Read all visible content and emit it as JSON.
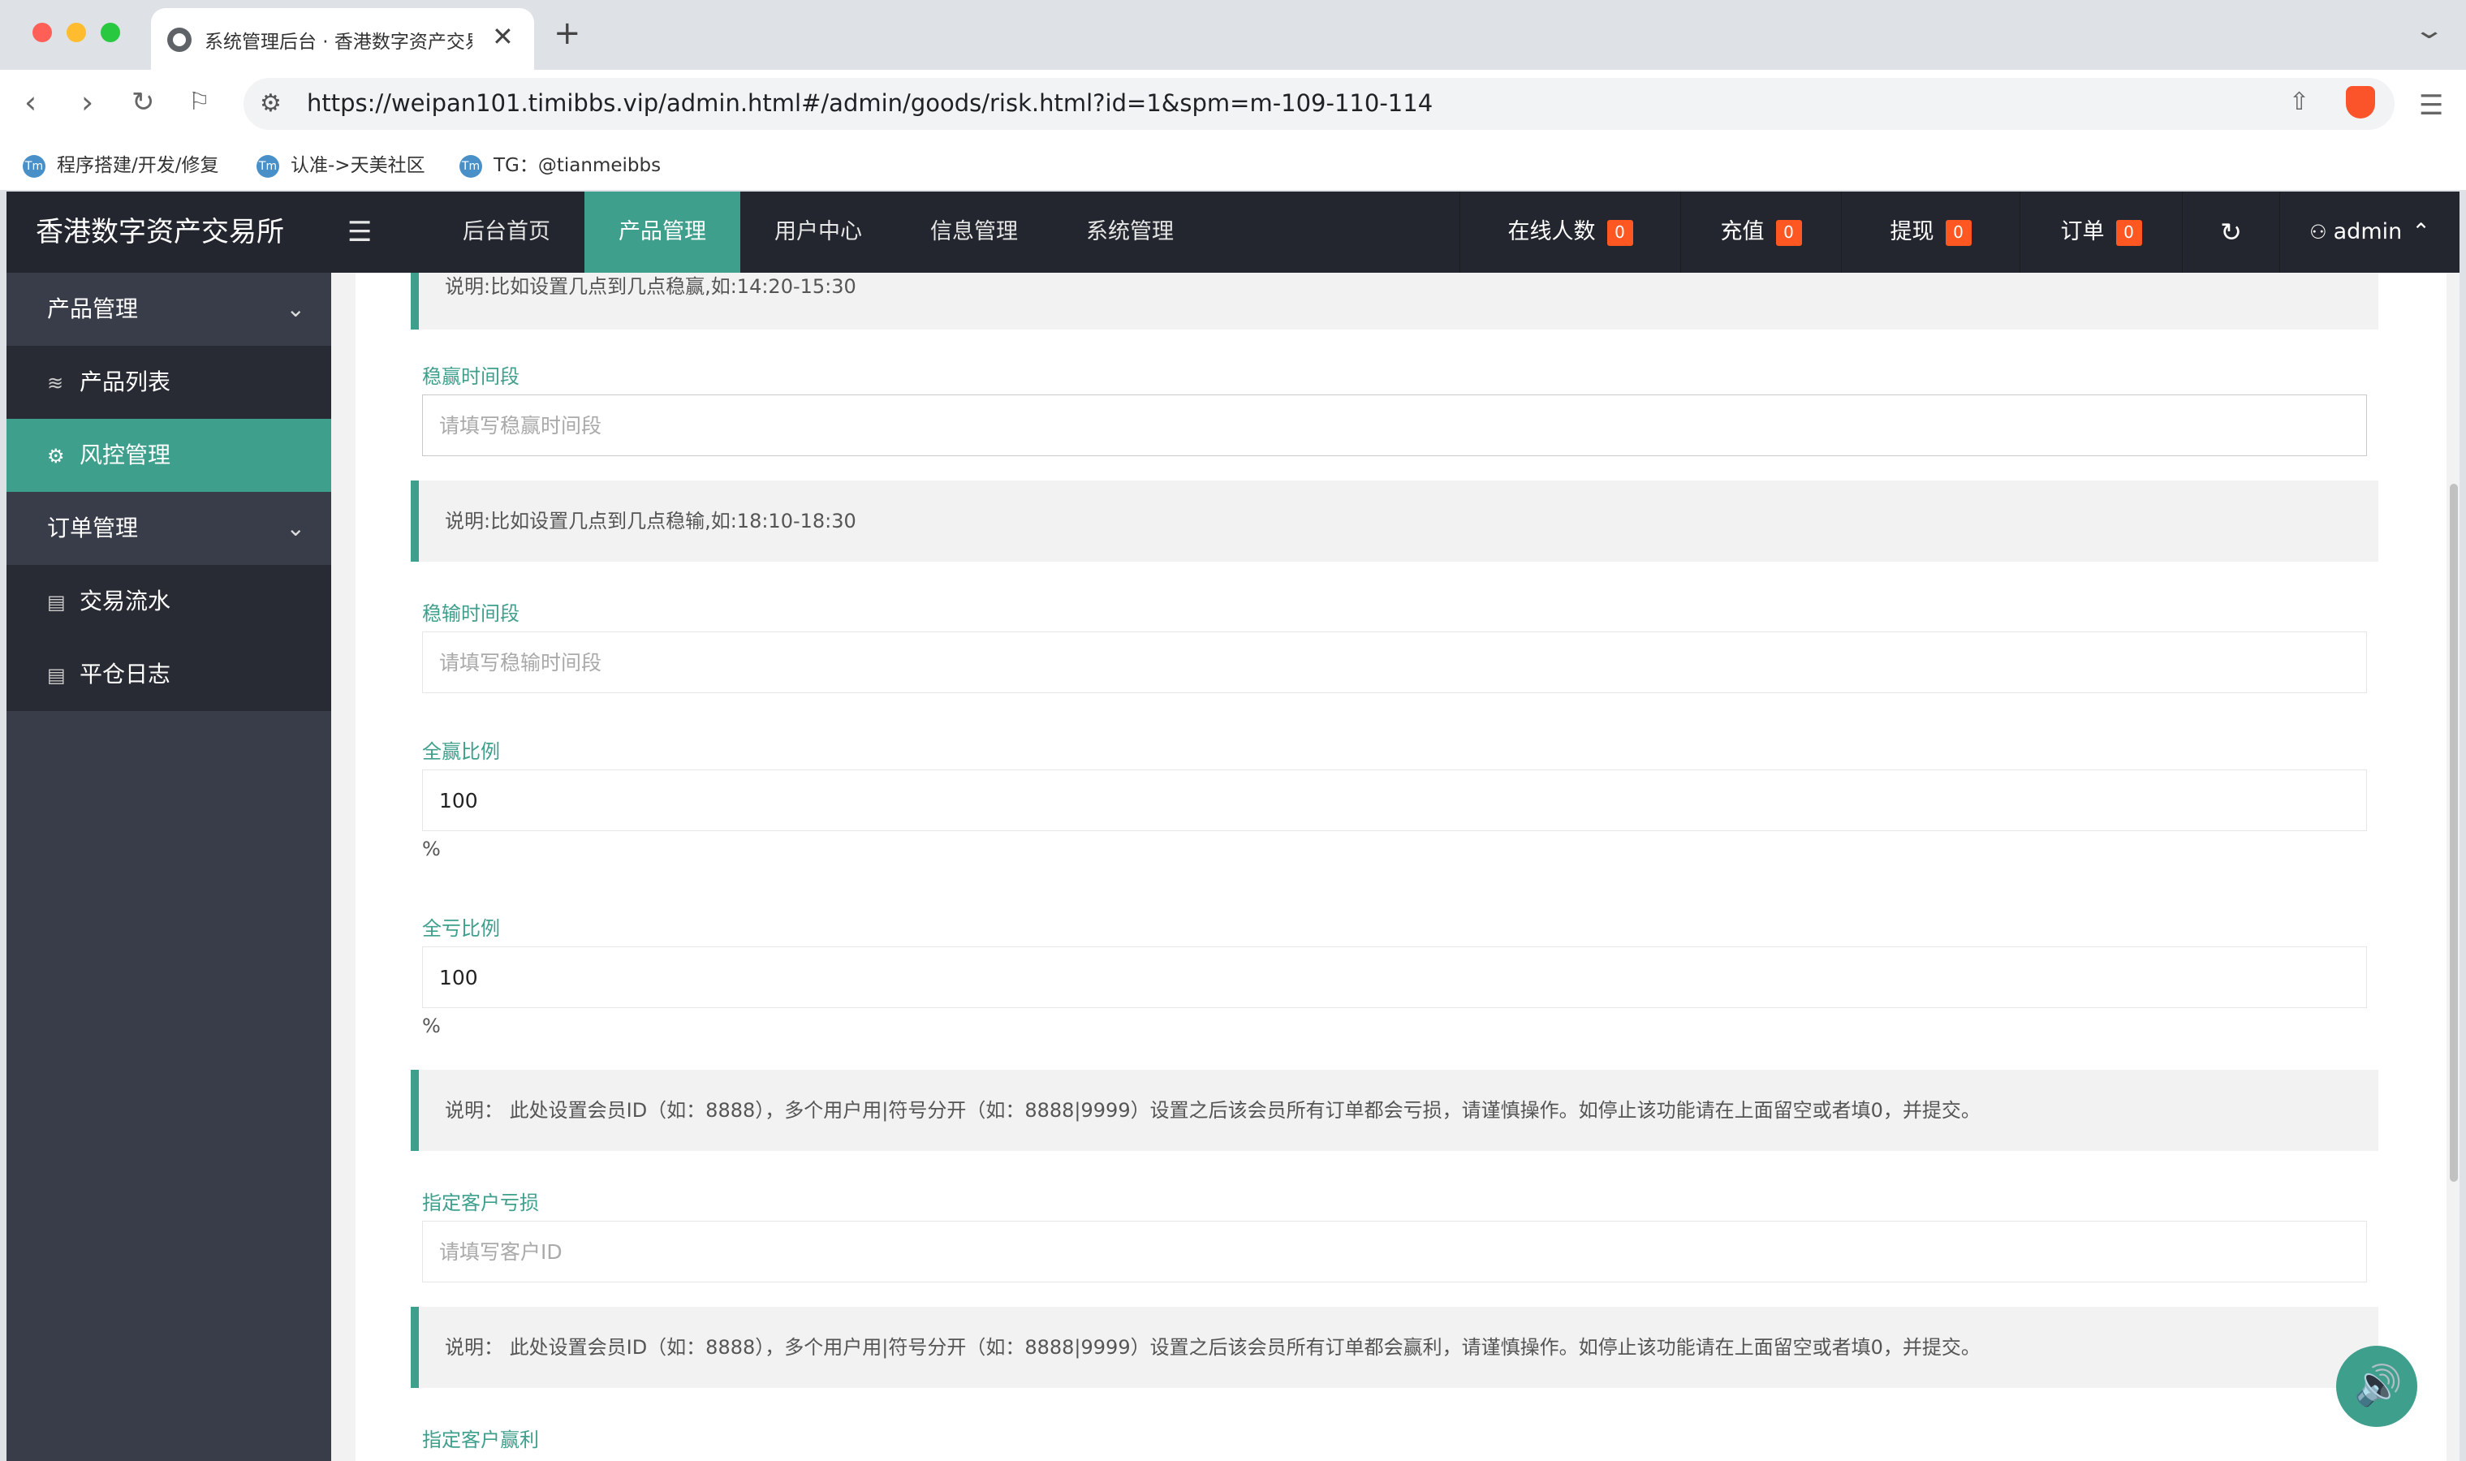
{
  "browser": {
    "tab_title": "系统管理后台 · 香港数字资产交易所",
    "tab_close": "✕",
    "new_tab": "+",
    "url": "https://weipan101.timibbs.vip/admin.html#/admin/goods/risk.html?id=1&spm=m-109-110-114",
    "bookmarks": [
      {
        "label": "程序搭建/开发/修复"
      },
      {
        "label": "认准->天美社区"
      },
      {
        "label": "TG：@tianmeibbs"
      }
    ]
  },
  "app": {
    "brand": "香港数字资产交易所",
    "nav": [
      {
        "label": "后台首页"
      },
      {
        "label": "产品管理"
      },
      {
        "label": "用户中心"
      },
      {
        "label": "信息管理"
      },
      {
        "label": "系统管理"
      }
    ],
    "stats": [
      {
        "label": "在线人数",
        "count": "0"
      },
      {
        "label": "充值",
        "count": "0"
      },
      {
        "label": "提现",
        "count": "0"
      },
      {
        "label": "订单",
        "count": "0"
      }
    ],
    "user": "admin"
  },
  "sidebar": {
    "groups": [
      {
        "label": "产品管理"
      },
      {
        "label": "订单管理"
      }
    ],
    "items": [
      {
        "label": "产品列表"
      },
      {
        "label": "风控管理"
      },
      {
        "label": "交易流水"
      },
      {
        "label": "平仓日志"
      }
    ]
  },
  "form": {
    "tip_win_time": "说明:比如设置几点到几点稳赢,如:14:20-15:30",
    "win_time_label": "稳赢时间段",
    "win_time_placeholder": "请填写稳赢时间段",
    "tip_lose_time": "说明:比如设置几点到几点稳输,如:18:10-18:30",
    "lose_time_label": "稳输时间段",
    "lose_time_placeholder": "请填写稳输时间段",
    "all_win_label": "全赢比例",
    "all_win_value": "100",
    "all_win_unit": "%",
    "all_lose_label": "全亏比例",
    "all_lose_value": "100",
    "all_lose_unit": "%",
    "tip_lose_user": "说明： 此处设置会员ID（如：8888），多个用户用|符号分开（如：8888|9999）设置之后该会员所有订单都会亏损，请谨慎操作。如停止该功能请在上面留空或者填0，并提交。",
    "lose_user_label": "指定客户亏损",
    "lose_user_placeholder": "请填写客户ID",
    "tip_win_user": "说明： 此处设置会员ID（如：8888），多个用户用|符号分开（如：8888|9999）设置之后该会员所有订单都会赢利，请谨慎操作。如停止该功能请在上面留空或者填0，并提交。",
    "win_user_label": "指定客户赢利"
  }
}
